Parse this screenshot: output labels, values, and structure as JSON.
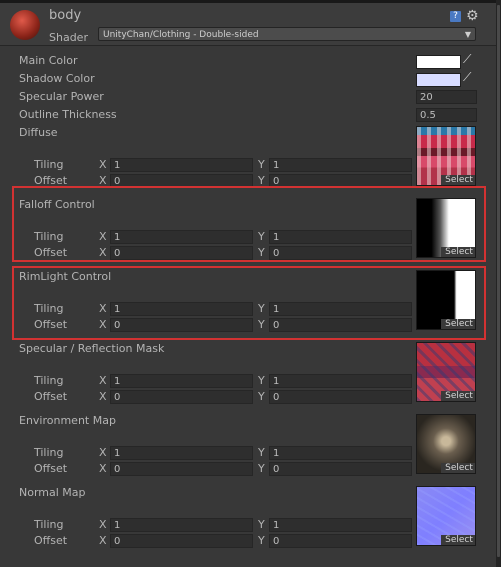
{
  "material_name": "body",
  "shader": {
    "label": "Shader",
    "value": "UnityChan/Clothing - Double-sided",
    "arrow": "▼"
  },
  "header_icons": {
    "help": "?",
    "gear": "⚙"
  },
  "colors": {
    "main_color": "#ffffff",
    "shadow_color": "#d7dbff",
    "highlight": "#d23232"
  },
  "props": {
    "main_color": "Main Color",
    "shadow_color": "Shadow Color",
    "specular_power": {
      "label": "Specular Power",
      "value": "20"
    },
    "outline_thickness": {
      "label": "Outline Thickness",
      "value": "0.5"
    }
  },
  "picker_glyph": "⟋",
  "tiling_label": "Tiling",
  "offset_label": "Offset",
  "x_label": "X",
  "y_label": "Y",
  "select_label": "Select",
  "textures": [
    {
      "label": "Diffuse",
      "tiling_x": "1",
      "tiling_y": "1",
      "offset_x": "0",
      "offset_y": "0",
      "thumb": "diffuse"
    },
    {
      "label": "Falloff Control",
      "tiling_x": "1",
      "tiling_y": "1",
      "offset_x": "0",
      "offset_y": "0",
      "thumb": "falloff"
    },
    {
      "label": "RimLight Control",
      "tiling_x": "1",
      "tiling_y": "1",
      "offset_x": "0",
      "offset_y": "0",
      "thumb": "rimlight"
    },
    {
      "label": "Specular / Reflection Mask",
      "tiling_x": "1",
      "tiling_y": "1",
      "offset_x": "0",
      "offset_y": "0",
      "thumb": "specular"
    },
    {
      "label": "Environment Map",
      "tiling_x": "1",
      "tiling_y": "1",
      "offset_x": "0",
      "offset_y": "0",
      "thumb": "envmap"
    },
    {
      "label": "Normal Map",
      "tiling_x": "1",
      "tiling_y": "1",
      "offset_x": "0",
      "offset_y": "0",
      "thumb": "normal"
    }
  ]
}
